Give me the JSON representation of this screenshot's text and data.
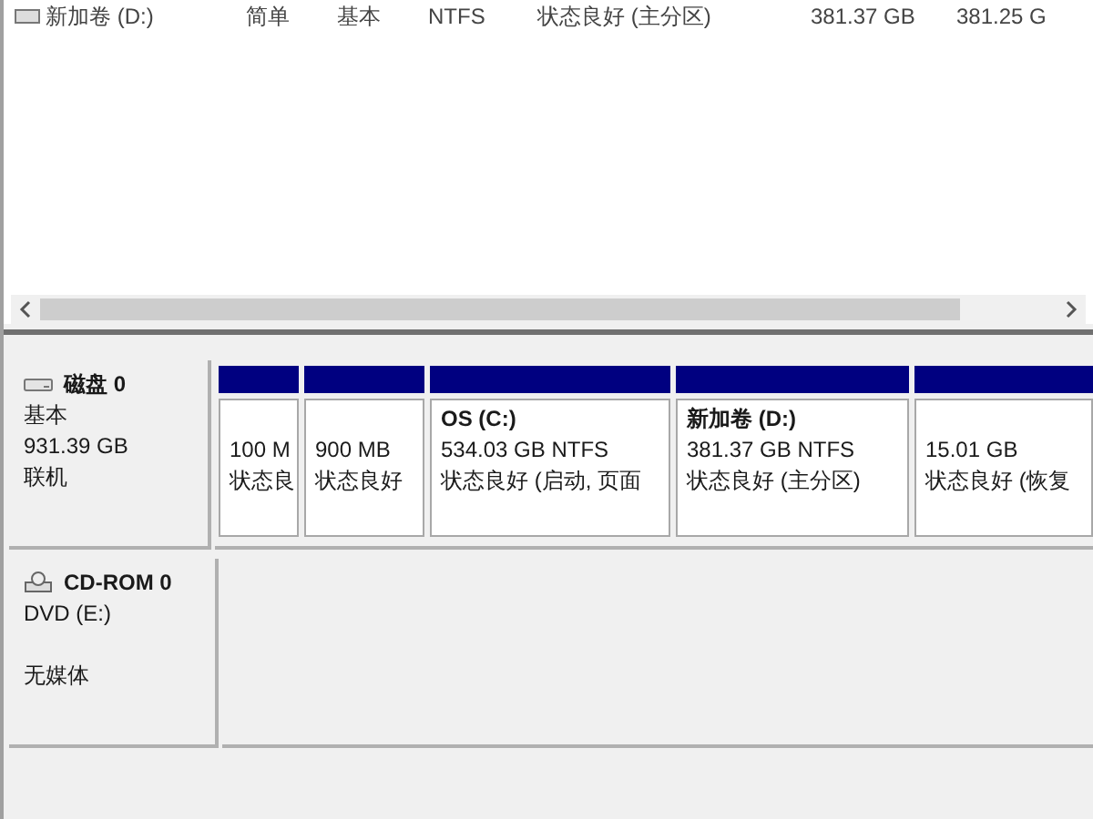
{
  "volume_list": {
    "rows": [
      {
        "cells": [
          "新加卷 (D:)",
          "简单",
          "基本",
          "NTFS",
          "状态良好 (主分区)",
          "381.37 GB",
          "381.25 G"
        ]
      }
    ]
  },
  "disks": [
    {
      "kind": "disk",
      "name": "磁盘 0",
      "lines": [
        "基本",
        "931.39 GB",
        "联机"
      ],
      "partitions": [
        {
          "size": "100 M",
          "status": "状态良"
        },
        {
          "size": "900 MB",
          "status": "状态良好"
        },
        {
          "title": "OS  (C:)",
          "size": "534.03 GB NTFS",
          "status": "状态良好 (启动, 页面"
        },
        {
          "title": "新加卷  (D:)",
          "size": "381.37 GB NTFS",
          "status": "状态良好 (主分区)"
        },
        {
          "size": "15.01 GB",
          "status": "状态良好 (恢复"
        }
      ]
    },
    {
      "kind": "cdrom",
      "name": "CD-ROM 0",
      "lines": [
        "DVD (E:)"
      ],
      "media": "无媒体"
    }
  ]
}
